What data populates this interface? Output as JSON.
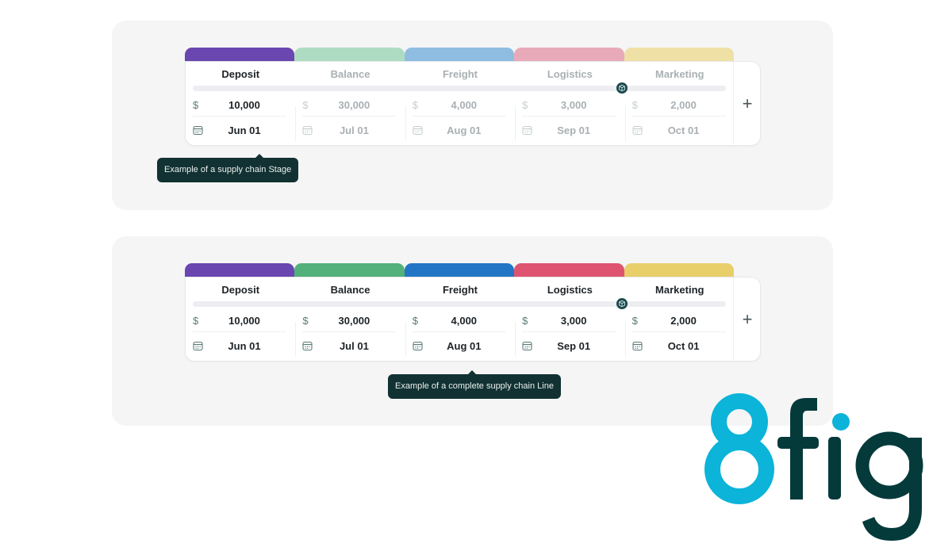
{
  "panels": [
    {
      "name": "stage-example",
      "stages": [
        {
          "label": "Deposit",
          "amount": "10,000",
          "date": "Jun 01",
          "color": "#6a46b0",
          "active": true
        },
        {
          "label": "Balance",
          "amount": "30,000",
          "date": "Jul 01",
          "color": "#aedcc3",
          "active": false
        },
        {
          "label": "Freight",
          "amount": "4,000",
          "date": "Aug 01",
          "color": "#8fbde2",
          "active": false
        },
        {
          "label": "Logistics",
          "amount": "3,000",
          "date": "Sep 01",
          "color": "#e8aab9",
          "active": false
        },
        {
          "label": "Marketing",
          "amount": "2,000",
          "date": "Oct 01",
          "color": "#efe1a6",
          "active": false
        }
      ],
      "tooltip": "Example of a supply chain Stage"
    },
    {
      "name": "line-example",
      "stages": [
        {
          "label": "Deposit",
          "amount": "10,000",
          "date": "Jun 01",
          "color": "#6a46b0",
          "active": true
        },
        {
          "label": "Balance",
          "amount": "30,000",
          "date": "Jul 01",
          "color": "#52b07a",
          "active": true
        },
        {
          "label": "Freight",
          "amount": "4,000",
          "date": "Aug 01",
          "color": "#2275c4",
          "active": true
        },
        {
          "label": "Logistics",
          "amount": "3,000",
          "date": "Sep 01",
          "color": "#de5470",
          "active": true
        },
        {
          "label": "Marketing",
          "amount": "2,000",
          "date": "Oct 01",
          "color": "#e8cf6a",
          "active": true
        }
      ],
      "tooltip": "Example of a complete supply chain Line"
    }
  ],
  "icons": {
    "currency": "$",
    "add": "+",
    "calendar": "calendar-icon",
    "box": "box-icon"
  },
  "logo": {
    "text_digit": "8",
    "text_rest": "fig",
    "digit_color": "#0bb4d8",
    "rest_color": "#053a3b"
  }
}
